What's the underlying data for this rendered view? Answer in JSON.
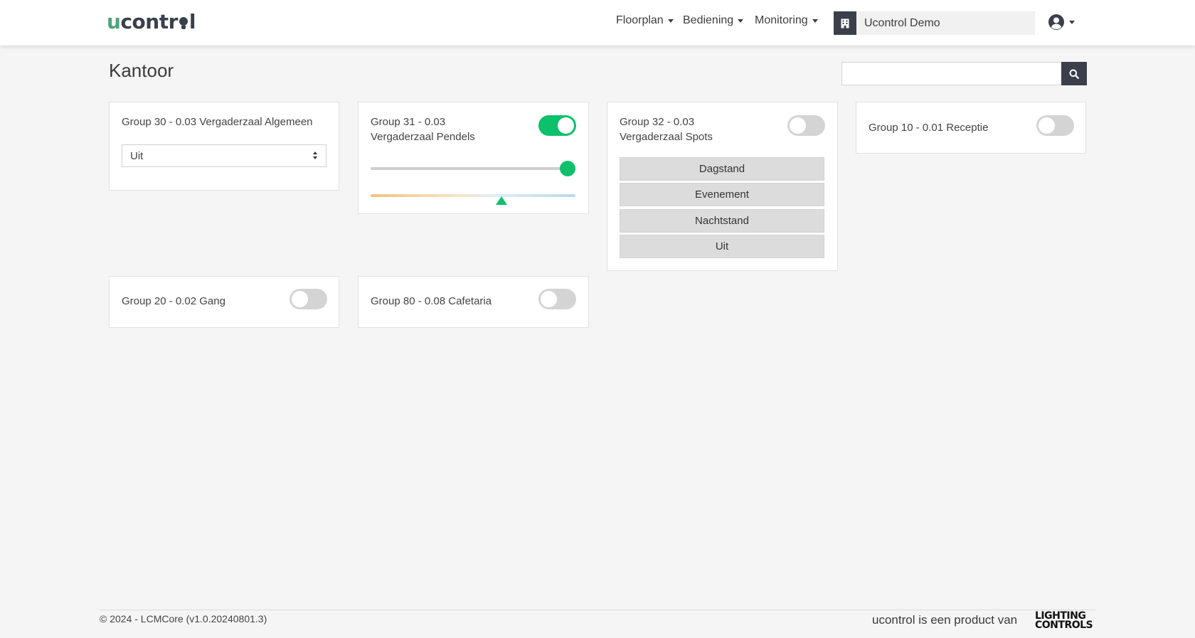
{
  "navbar": {
    "logo": {
      "first": "u",
      "before_bulb": "contr",
      "after_bulb": "l"
    },
    "menu": [
      {
        "label": "Floorplan"
      },
      {
        "label": "Bediening"
      },
      {
        "label": "Monitoring"
      }
    ],
    "site_name": "Ucontrol Demo",
    "icons": {
      "site": "building-icon",
      "user": "user-circle-icon"
    }
  },
  "page": {
    "title": "Kantoor",
    "search": {
      "value": "",
      "placeholder": ""
    }
  },
  "cards": {
    "group30": {
      "title": "Group 30 - 0.03 Vergaderzaal Algemeen",
      "selected": "Uit"
    },
    "group31": {
      "title_line1": "Group 31 - 0.03",
      "title_line2": "Vergaderzaal Pendels",
      "toggle": "on",
      "dim_level": 1.0,
      "color_temp_level": 0.64
    },
    "group32": {
      "title_line1": "Group 32 - 0.03",
      "title_line2": "Vergaderzaal Spots",
      "toggle": "off",
      "scenes": [
        "Dagstand",
        "Evenement",
        "Nachtstand",
        "Uit"
      ]
    },
    "group10": {
      "title": "Group 10 - 0.01 Receptie",
      "toggle": "off"
    },
    "group20": {
      "title": "Group 20 - 0.02 Gang",
      "toggle": "off"
    },
    "group80": {
      "title": "Group 80 - 0.08 Cafetaria",
      "toggle": "off"
    }
  },
  "colors": {
    "accent": "#0dc06b",
    "dark": "#3a3f4b",
    "logo_green": "#4aa57b"
  },
  "footer": {
    "copyright": "© 2024 - LCMCore (v1.0.20240801.3)",
    "product_text": "ucontrol is een product van",
    "brand_line1": "LIGHTING",
    "brand_line2": "CONTROLS"
  }
}
